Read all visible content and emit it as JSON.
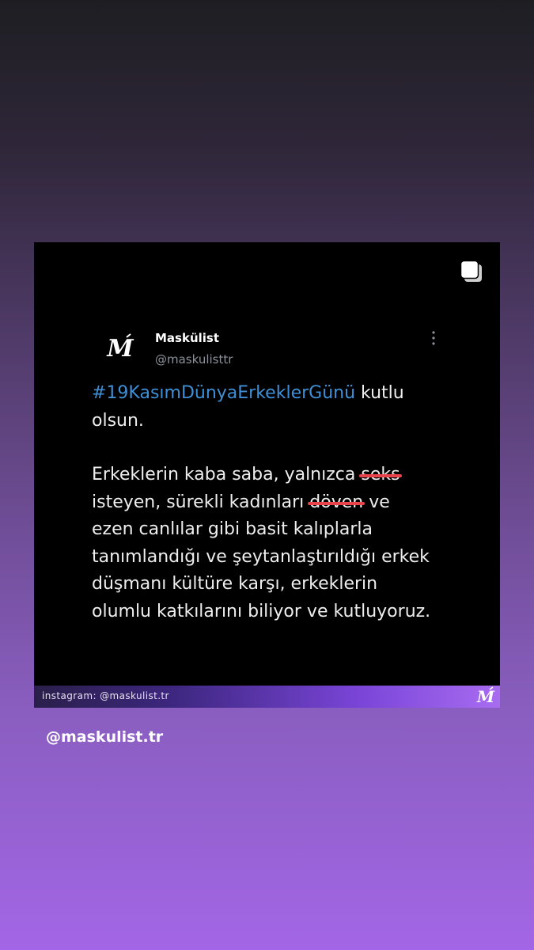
{
  "post": {
    "account": {
      "display_name": "Maskülist",
      "handle": "@maskulisttr",
      "logo_text": "M"
    },
    "text": {
      "hashtag": "#19KasımDünyaErkeklerGünü",
      "line1_rest": " kutlu",
      "line2": "olsun.",
      "p2_a": "Erkeklerin kaba saba, yalnızca ",
      "strike1": "seks",
      "p2_b": "isteyen, sürekli kadınları ",
      "strike2": "döven",
      "p2_c": " ve",
      "p2_d": "ezen canlılar gibi basit kalıplarla",
      "p2_e": "tanımlandığı ve şeytanlaştırıldığı erkek",
      "p2_f": "düşmanı kültüre karşı, erkeklerin",
      "p2_g": "olumlu katkılarını biliyor ve kutluyoruz."
    },
    "footer": {
      "label": "instagram: @maskulist.tr",
      "logo_text": "M"
    }
  },
  "story": {
    "mention": "@maskulist.tr"
  },
  "colors": {
    "hashtag": "#3f8fd6",
    "strike": "#e8434a",
    "card_bg": "#000000"
  },
  "icons": [
    "multiple-photos-icon",
    "more-options-icon",
    "maskulist-logo"
  ]
}
